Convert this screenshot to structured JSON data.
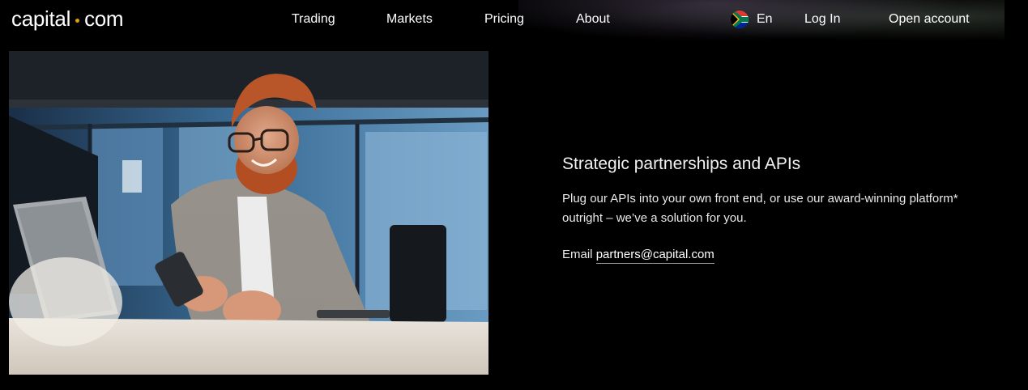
{
  "header": {
    "logo_left": "capital",
    "logo_right": "com",
    "nav": {
      "trading": "Trading",
      "markets": "Markets",
      "pricing": "Pricing",
      "about": "About"
    },
    "language": "En",
    "login": "Log In",
    "open_account": "Open account"
  },
  "section": {
    "heading": "Strategic partnerships and APIs",
    "body": "Plug our APIs into your own front end, or use our award-winning platform* outright – we’ve a solution for you.",
    "email_label": "Email",
    "email_address": "partners@capital.com"
  },
  "icons": {
    "language_flag": "south-africa-flag-icon",
    "logo_dot_color": "#e0a000"
  },
  "colors": {
    "background": "#000000",
    "text": "#ffffff"
  }
}
